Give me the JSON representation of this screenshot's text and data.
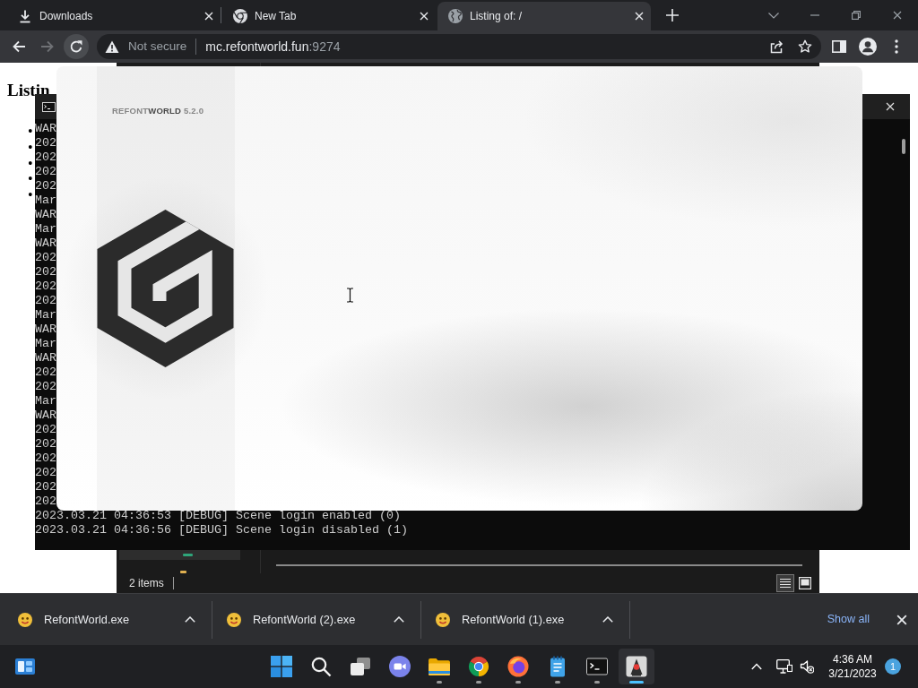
{
  "browser": {
    "tabs": [
      {
        "title": "Downloads",
        "kind": "downloads",
        "selected": false
      },
      {
        "title": "New Tab",
        "kind": "newtab",
        "selected": false
      },
      {
        "title": "Listing of: /",
        "kind": "site",
        "selected": true
      }
    ],
    "nav_buttons": [
      {
        "kind": "back",
        "disabled": false,
        "hovered": false
      },
      {
        "kind": "forward",
        "disabled": true,
        "hovered": false
      },
      {
        "kind": "reload",
        "disabled": false,
        "hovered": true
      }
    ],
    "address_bar": {
      "security": "Not secure",
      "host": "mc.refontworld.fun",
      "port": ":9274"
    },
    "page": {
      "heading": "Listin",
      "bullets": [
        "•",
        "•",
        "•",
        "•",
        "•"
      ]
    },
    "downloads": {
      "items": [
        {
          "name": "RefontWorld.exe"
        },
        {
          "name": "RefontWorld (2).exe"
        },
        {
          "name": "RefontWorld (1).exe"
        }
      ],
      "show_all": "Show all"
    }
  },
  "console": {
    "lines": [
      "WAR",
      "202",
      "202",
      "202",
      "202",
      "Mar",
      "WAR",
      "Mar",
      "WAR",
      "202",
      "202",
      "202",
      "202",
      "Mar",
      "WAR",
      "Mar",
      "WAR",
      "202",
      "202",
      "Mar",
      "WAR",
      "202",
      "202",
      "202",
      "202",
      "202",
      "202",
      "2023.03.21 04:36:53 [DEBUG] Scene login enabled (0)",
      "2023.03.21 04:36:56 [DEBUG] Scene login disabled (1)"
    ]
  },
  "explorer": {
    "status": "2 items",
    "views": [
      {
        "kind": "details",
        "selected": true
      },
      {
        "kind": "tiles",
        "selected": false
      }
    ]
  },
  "splash": {
    "brand": "REFONT**WORLD** 5.2.0"
  },
  "taskbar": {
    "apps": [
      {
        "kind": "start",
        "running": false,
        "active": false
      },
      {
        "kind": "search",
        "running": false,
        "active": false
      },
      {
        "kind": "taskview",
        "running": false,
        "active": false
      },
      {
        "kind": "chat",
        "running": false,
        "active": false
      },
      {
        "kind": "files",
        "running": true,
        "active": false
      },
      {
        "kind": "browser",
        "running": true,
        "active": false
      },
      {
        "kind": "fox_browser",
        "running": true,
        "active": false
      },
      {
        "kind": "notepad",
        "running": true,
        "active": false
      },
      {
        "kind": "terminal",
        "running": true,
        "active": false
      },
      {
        "kind": "app",
        "running": true,
        "active": true
      }
    ],
    "clock": {
      "time": "4:36 AM",
      "date": "3/21/2023"
    },
    "notifications": "1"
  }
}
